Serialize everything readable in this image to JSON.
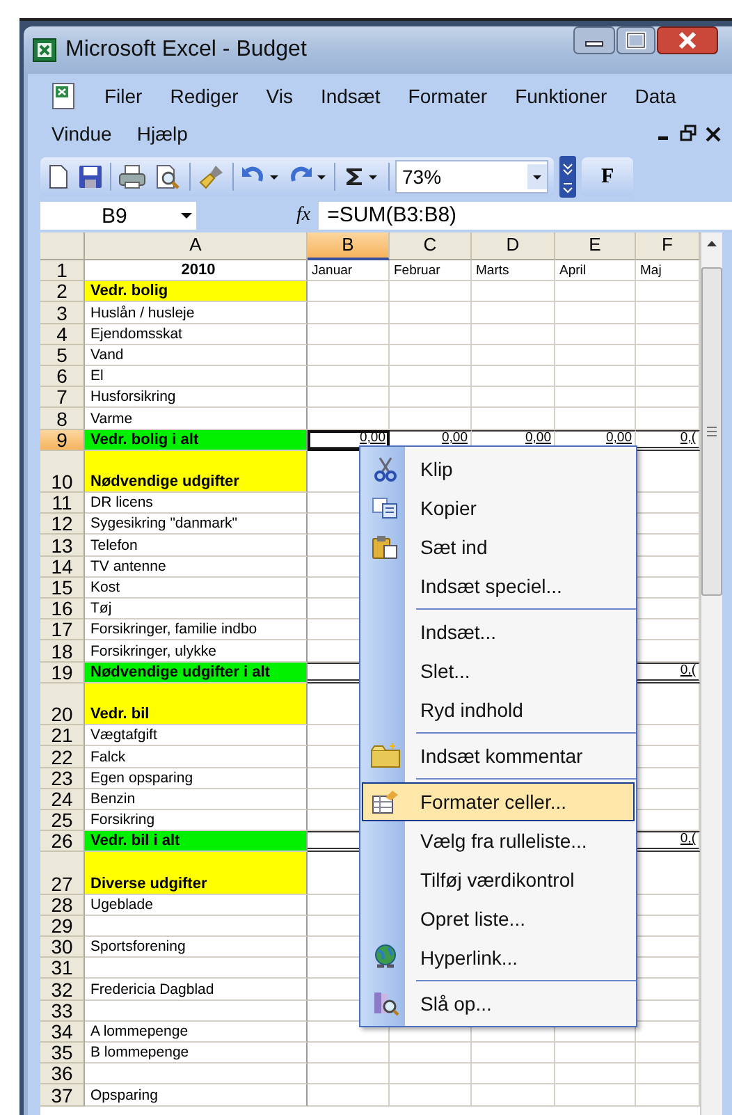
{
  "window": {
    "title": "Microsoft Excel - Budget"
  },
  "menu_bar": {
    "items": [
      "Filer",
      "Rediger",
      "Vis",
      "Indsæt",
      "Formater",
      "Funktioner",
      "Data",
      "Vindue",
      "Hjælp"
    ]
  },
  "toolbar": {
    "zoom": "73%",
    "bold_button": "F"
  },
  "formula_bar": {
    "name_box": "B9",
    "function_button": "fx",
    "formula": "=SUM(B3:B8)"
  },
  "columns": [
    {
      "label": "A",
      "selected": false
    },
    {
      "label": "B",
      "selected": true
    },
    {
      "label": "C",
      "selected": false
    },
    {
      "label": "D",
      "selected": false
    },
    {
      "label": "E",
      "selected": false
    },
    {
      "label": "F",
      "selected": false
    }
  ],
  "rows": [
    {
      "num": "1",
      "kind": "title",
      "tall": false,
      "selected": false,
      "label": "2010",
      "cells": [
        "Januar",
        "Februar",
        "Marts",
        "April",
        "Maj"
      ]
    },
    {
      "num": "2",
      "kind": "section",
      "tall": false,
      "selected": false,
      "label": "Vedr. bolig"
    },
    {
      "num": "3",
      "kind": "item",
      "tall": false,
      "selected": false,
      "label": "Huslån / husleje"
    },
    {
      "num": "4",
      "kind": "item",
      "tall": false,
      "selected": false,
      "label": "Ejendomsskat"
    },
    {
      "num": "5",
      "kind": "item",
      "tall": false,
      "selected": false,
      "label": "Vand"
    },
    {
      "num": "6",
      "kind": "item",
      "tall": false,
      "selected": false,
      "label": "El"
    },
    {
      "num": "7",
      "kind": "item",
      "tall": false,
      "selected": false,
      "label": "Husforsikring"
    },
    {
      "num": "8",
      "kind": "item",
      "tall": false,
      "selected": false,
      "label": "Varme"
    },
    {
      "num": "9",
      "kind": "total",
      "tall": false,
      "selected": true,
      "label": "Vedr. bolig i alt",
      "cells": [
        "0,00",
        "0,00",
        "0,00",
        "0,00",
        "0,("
      ]
    },
    {
      "num": "10",
      "kind": "section",
      "tall": true,
      "selected": false,
      "label": "Nødvendige udgifter"
    },
    {
      "num": "11",
      "kind": "item",
      "tall": false,
      "selected": false,
      "label": "DR licens"
    },
    {
      "num": "12",
      "kind": "item",
      "tall": false,
      "selected": false,
      "label": "Sygesikring \"danmark\""
    },
    {
      "num": "13",
      "kind": "item",
      "tall": false,
      "selected": false,
      "label": "Telefon"
    },
    {
      "num": "14",
      "kind": "item",
      "tall": false,
      "selected": false,
      "label": "TV antenne"
    },
    {
      "num": "15",
      "kind": "item",
      "tall": false,
      "selected": false,
      "label": "Kost"
    },
    {
      "num": "16",
      "kind": "item",
      "tall": false,
      "selected": false,
      "label": "Tøj"
    },
    {
      "num": "17",
      "kind": "item",
      "tall": false,
      "selected": false,
      "label": "Forsikringer, familie indbo"
    },
    {
      "num": "18",
      "kind": "item",
      "tall": false,
      "selected": false,
      "label": "Forsikringer, ulykke"
    },
    {
      "num": "19",
      "kind": "total",
      "tall": false,
      "selected": false,
      "label": "Nødvendige udgifter i alt",
      "last_cell": "0,("
    },
    {
      "num": "20",
      "kind": "section",
      "tall": true,
      "selected": false,
      "label": "Vedr. bil"
    },
    {
      "num": "21",
      "kind": "item",
      "tall": false,
      "selected": false,
      "label": "Vægtafgift"
    },
    {
      "num": "22",
      "kind": "item",
      "tall": false,
      "selected": false,
      "label": "Falck"
    },
    {
      "num": "23",
      "kind": "item",
      "tall": false,
      "selected": false,
      "label": "Egen opsparing"
    },
    {
      "num": "24",
      "kind": "item",
      "tall": false,
      "selected": false,
      "label": "Benzin"
    },
    {
      "num": "25",
      "kind": "item",
      "tall": false,
      "selected": false,
      "label": "Forsikring"
    },
    {
      "num": "26",
      "kind": "total",
      "tall": false,
      "selected": false,
      "label": "Vedr. bil i alt",
      "last_cell": "0,("
    },
    {
      "num": "27",
      "kind": "section",
      "tall": true,
      "selected": false,
      "label": "Diverse udgifter"
    },
    {
      "num": "28",
      "kind": "item",
      "tall": false,
      "selected": false,
      "label": "Ugeblade"
    },
    {
      "num": "29",
      "kind": "item",
      "tall": false,
      "selected": false
    },
    {
      "num": "30",
      "kind": "item",
      "tall": false,
      "selected": false,
      "label": "Sportsforening"
    },
    {
      "num": "31",
      "kind": "item",
      "tall": false,
      "selected": false
    },
    {
      "num": "32",
      "kind": "item",
      "tall": false,
      "selected": false,
      "label": "Fredericia Dagblad"
    },
    {
      "num": "33",
      "kind": "item",
      "tall": false,
      "selected": false
    },
    {
      "num": "34",
      "kind": "item",
      "tall": false,
      "selected": false,
      "label": "A lommepenge"
    },
    {
      "num": "35",
      "kind": "item",
      "tall": false,
      "selected": false,
      "label": "B lommepenge"
    },
    {
      "num": "36",
      "kind": "item",
      "tall": false,
      "selected": false
    },
    {
      "num": "37",
      "kind": "item",
      "tall": false,
      "selected": false,
      "label": "Opsparing"
    }
  ],
  "context_menu": {
    "items": [
      {
        "label": "Klip",
        "kind": "cut",
        "separator_before": false,
        "selected": false
      },
      {
        "label": "Kopier",
        "kind": "copy",
        "separator_before": false,
        "selected": false
      },
      {
        "label": "Sæt ind",
        "kind": "paste",
        "separator_before": false,
        "selected": false
      },
      {
        "label": "Indsæt speciel...",
        "kind": "plain",
        "separator_before": false,
        "selected": false
      },
      {
        "label": "Indsæt...",
        "kind": "plain",
        "separator_before": true,
        "selected": false
      },
      {
        "label": "Slet...",
        "kind": "plain",
        "separator_before": false,
        "selected": false
      },
      {
        "label": "Ryd indhold",
        "kind": "plain",
        "separator_before": false,
        "selected": false
      },
      {
        "label": "Indsæt kommentar",
        "kind": "comment",
        "separator_before": true,
        "selected": false
      },
      {
        "label": "Formater celler...",
        "kind": "format",
        "separator_before": true,
        "selected": true
      },
      {
        "label": "Vælg fra rulleliste...",
        "kind": "plain",
        "separator_before": false,
        "selected": false
      },
      {
        "label": "Tilføj værdikontrol",
        "kind": "plain",
        "separator_before": false,
        "selected": false
      },
      {
        "label": "Opret liste...",
        "kind": "plain",
        "separator_before": false,
        "selected": false
      },
      {
        "label": "Hyperlink...",
        "kind": "hyperlink",
        "separator_before": false,
        "selected": false
      },
      {
        "label": "Slå op...",
        "kind": "lookup",
        "separator_before": true,
        "selected": false
      }
    ]
  }
}
